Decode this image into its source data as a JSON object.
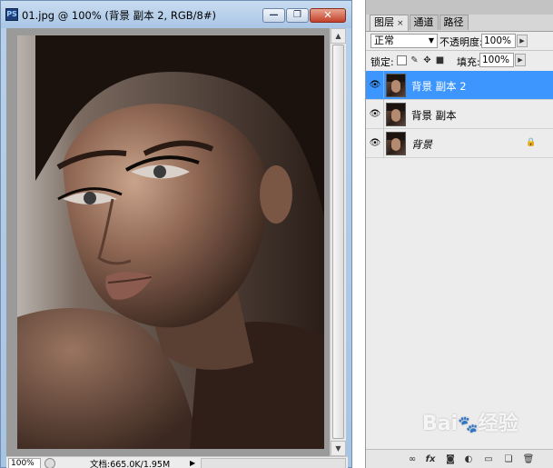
{
  "document_window": {
    "app_icon": "PS",
    "title": "01.jpg @ 100% (背景 副本 2, RGB/8#)",
    "controls": {
      "minimize": "—",
      "restore": "❐",
      "close": "✕"
    }
  },
  "status_bar": {
    "zoom": "100%",
    "doc_info": "文档:665.0K/1.95M",
    "arrow": "▶"
  },
  "layers_panel": {
    "tabs": [
      {
        "label": "图层",
        "close": "×",
        "active": true
      },
      {
        "label": "通道",
        "active": false
      },
      {
        "label": "路径",
        "active": false
      }
    ],
    "blend_mode": "正常",
    "opacity_label": "不透明度:",
    "opacity_value": "100%",
    "lock_label": "锁定:",
    "fill_label": "填充:",
    "fill_value": "100%",
    "layers": [
      {
        "name": "背景 副本 2",
        "selected": true,
        "visible": true,
        "locked": false
      },
      {
        "name": "背景 副本",
        "selected": false,
        "visible": true,
        "locked": false
      },
      {
        "name": "背景",
        "selected": false,
        "visible": true,
        "locked": true
      }
    ],
    "bottom_icons": [
      "link-icon",
      "fx-icon",
      "mask-icon",
      "adjustment-icon",
      "group-icon",
      "new-layer-icon",
      "trash-icon"
    ]
  },
  "watermark": {
    "text": "Bai 经验",
    "brand": "Bai",
    "suffix": "经验"
  },
  "colors": {
    "selected_layer": "#3d96fd",
    "window_frame": "#a9c6e6",
    "panel_bg": "#ececec"
  }
}
